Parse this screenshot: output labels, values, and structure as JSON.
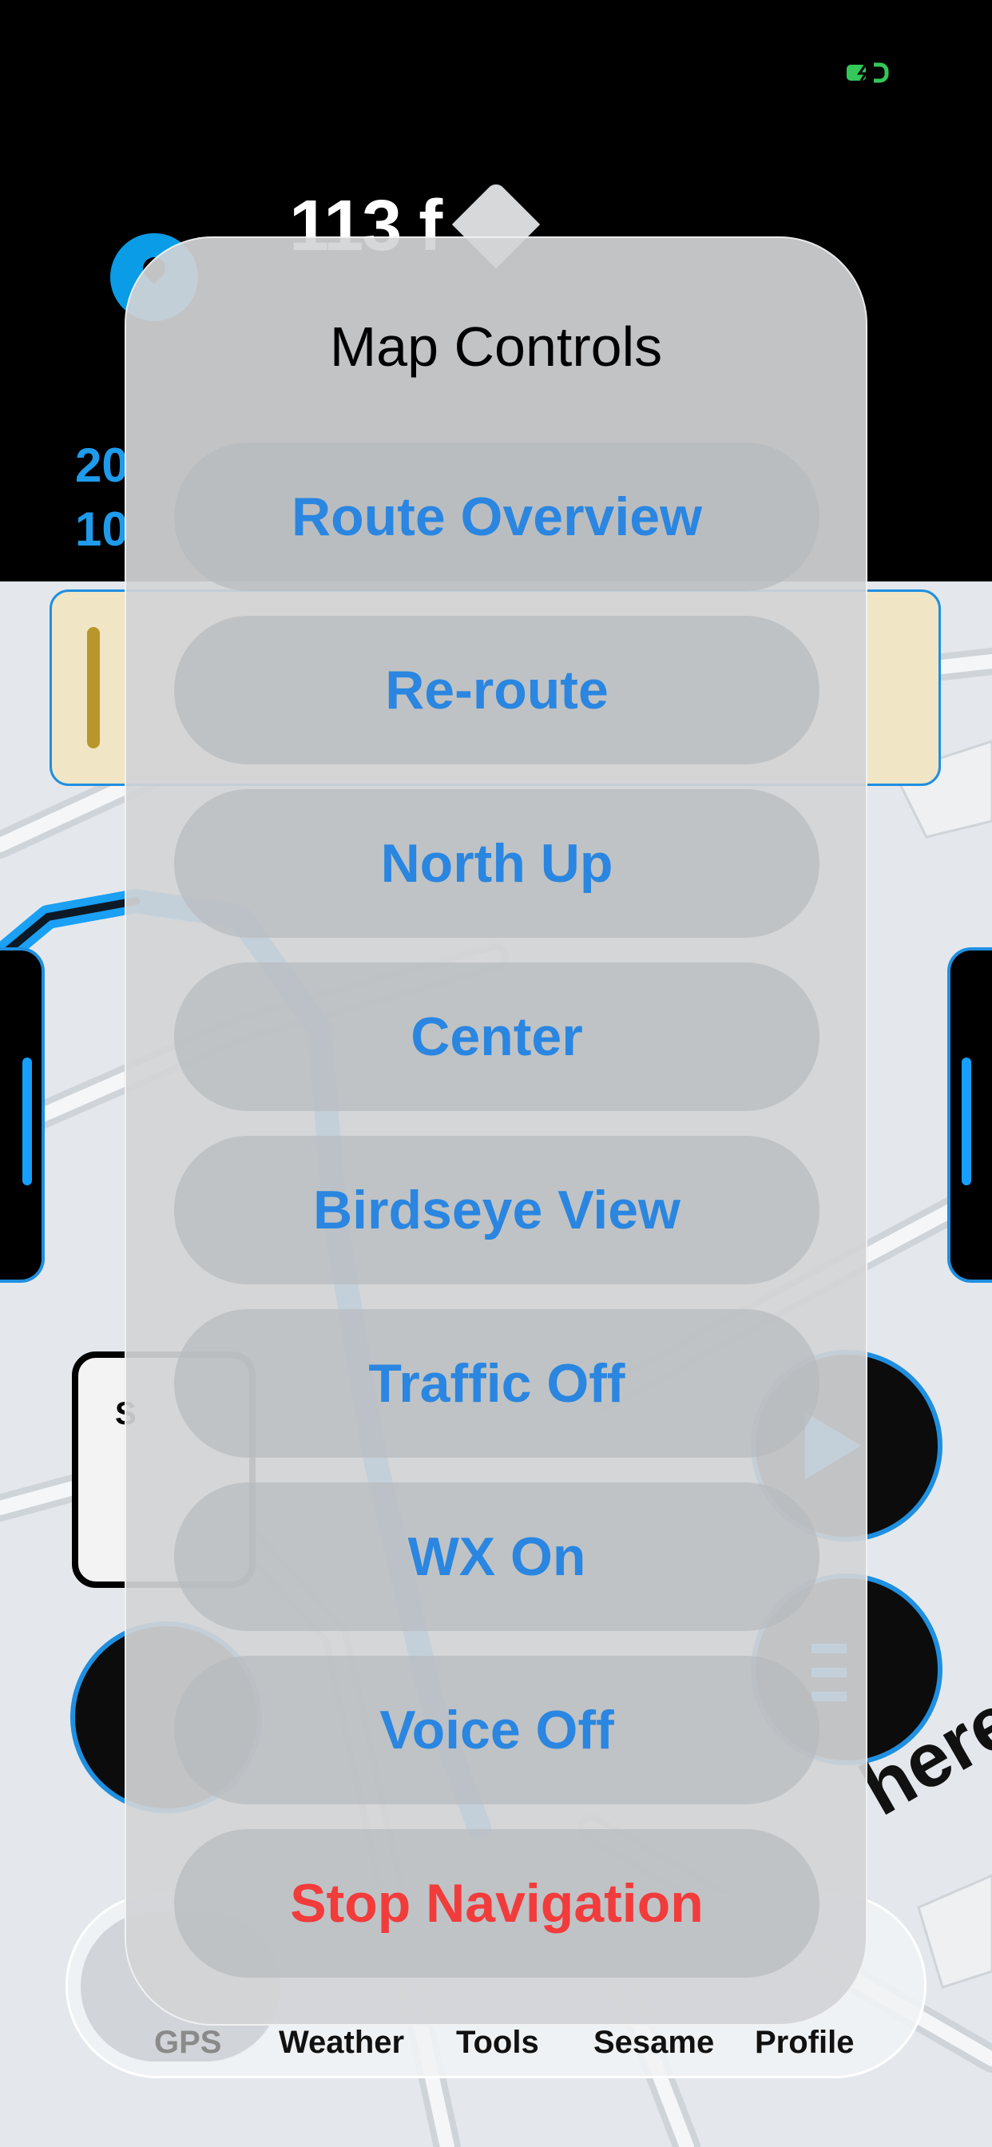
{
  "status_bar": {
    "battery_color": "#34c759"
  },
  "navigation": {
    "distance": "113 f",
    "eta_primary": "20",
    "eta_secondary": "10"
  },
  "map": {
    "speed_card_label": "S",
    "logo_text": "here"
  },
  "tab_bar": {
    "items": [
      {
        "label": "GPS",
        "selected": true
      },
      {
        "label": "Weather",
        "selected": false
      },
      {
        "label": "Tools",
        "selected": false
      },
      {
        "label": "Sesame",
        "selected": false
      },
      {
        "label": "Profile",
        "selected": false
      }
    ]
  },
  "map_controls": {
    "title": "Map Controls",
    "buttons": [
      {
        "label": "Route Overview"
      },
      {
        "label": "Re-route"
      },
      {
        "label": "North Up"
      },
      {
        "label": "Center"
      },
      {
        "label": "Birdseye View"
      },
      {
        "label": "Traffic Off"
      },
      {
        "label": "WX On"
      },
      {
        "label": "Voice Off"
      },
      {
        "label": "Stop Navigation",
        "style": "destructive"
      }
    ]
  },
  "colors": {
    "accent_blue": "#2a86e0",
    "route_blue": "#1aa0f5",
    "destructive_red": "#f23b3b",
    "alert_yellow": "#f0e6c6"
  }
}
